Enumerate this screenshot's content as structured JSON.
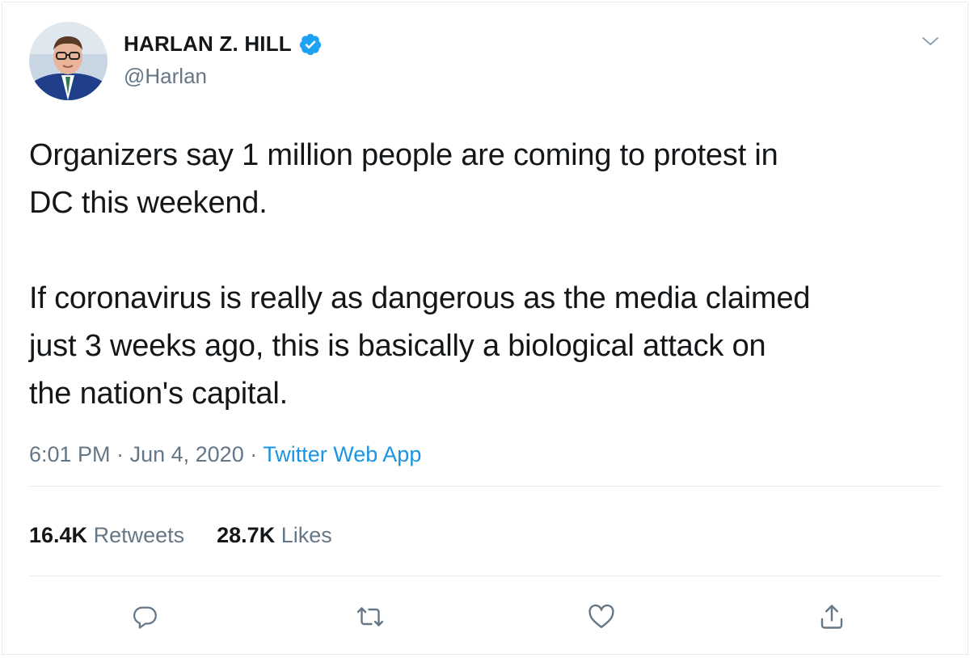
{
  "tweet": {
    "author": {
      "display_name": "HARLAN Z. HILL",
      "handle": "@Harlan",
      "verified": true
    },
    "body": "Organizers say 1 million people are coming to protest in\nDC this weekend.\n\nIf coronavirus is really as dangerous as the media claimed\njust 3 weeks ago, this is basically a biological attack on\nthe nation's capital.",
    "time": "6:01 PM",
    "separator": "·",
    "date": "Jun 4, 2020",
    "source": "Twitter Web App",
    "stats": {
      "retweets_count": "16.4K",
      "retweets_label": "Retweets",
      "likes_count": "28.7K",
      "likes_label": "Likes"
    },
    "actions": {
      "reply": "reply-icon",
      "retweet": "retweet-icon",
      "like": "heart-icon",
      "share": "share-icon"
    }
  },
  "colors": {
    "text": "#14171a",
    "secondary": "#657786",
    "link": "#1b95e0",
    "verified": "#1da1f2",
    "border": "#e6ecf0"
  }
}
